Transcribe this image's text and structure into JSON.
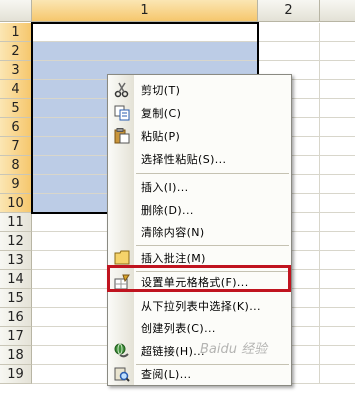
{
  "columns": [
    "1",
    "2"
  ],
  "rows": [
    "1",
    "2",
    "3",
    "4",
    "5",
    "6",
    "7",
    "8",
    "9",
    "10",
    "11",
    "12",
    "13",
    "14",
    "15",
    "16",
    "17",
    "18",
    "19"
  ],
  "selected_rows": 10,
  "context_menu": {
    "items": [
      {
        "label": "剪切(T)",
        "icon": "scissors-icon"
      },
      {
        "label": "复制(C)",
        "icon": "copy-icon"
      },
      {
        "label": "粘贴(P)",
        "icon": "paste-icon"
      },
      {
        "label": "选择性粘贴(S)...",
        "icon": ""
      },
      {
        "label": "插入(I)...",
        "icon": ""
      },
      {
        "label": "删除(D)...",
        "icon": ""
      },
      {
        "label": "清除内容(N)",
        "icon": ""
      },
      {
        "label": "插入批注(M)",
        "icon": "comment-icon"
      },
      {
        "label": "设置单元格格式(F)...",
        "icon": "format-cells-icon"
      },
      {
        "label": "从下拉列表中选择(K)...",
        "icon": ""
      },
      {
        "label": "创建列表(C)...",
        "icon": ""
      },
      {
        "label": "超链接(H)...",
        "icon": "hyperlink-icon"
      },
      {
        "label": "查阅(L)...",
        "icon": "lookup-icon"
      }
    ]
  },
  "watermark": "Baidu 经验",
  "colors": {
    "selection": "#bccce6",
    "highlight": "#c0141f"
  }
}
